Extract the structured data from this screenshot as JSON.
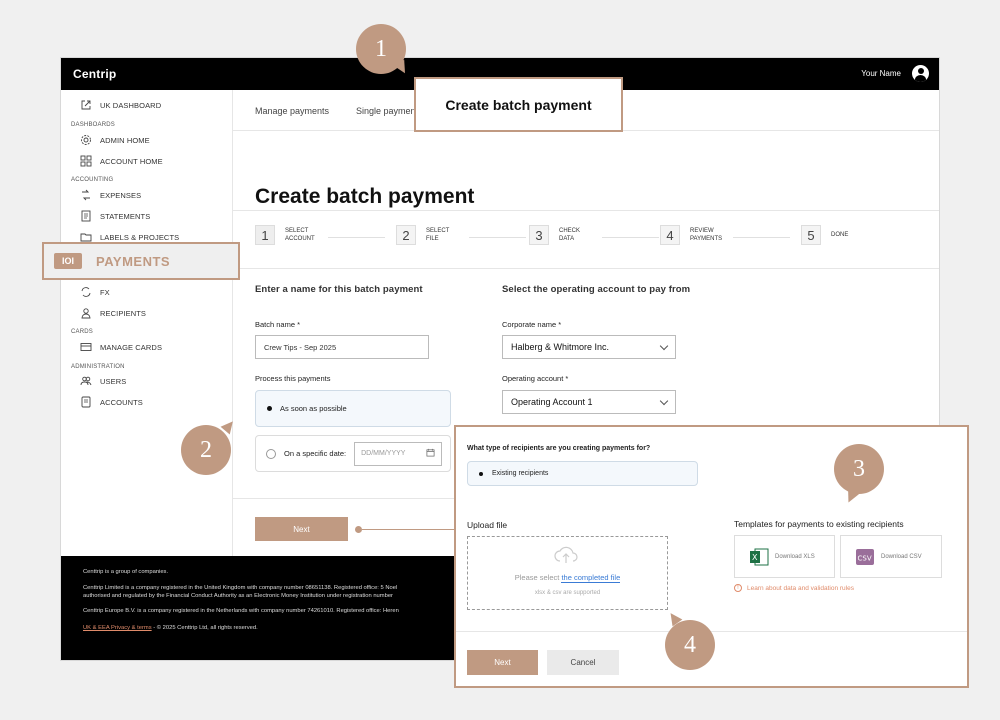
{
  "topbar": {
    "brand": "Centrip",
    "user_name": "Your Name"
  },
  "sidebar": {
    "uk_dashboard": "UK DASHBOARD",
    "section_dashboards": "DASHBOARDS",
    "admin_home": "ADMIN HOME",
    "account_home": "ACCOUNT HOME",
    "section_accounting": "ACCOUNTING",
    "expenses": "EXPENSES",
    "statements": "STATEMENTS",
    "labels_projects": "LABELS & PROJECTS",
    "payments": "PAYMENTS",
    "fx": "FX",
    "recipients": "RECIPIENTS",
    "section_cards": "CARDS",
    "manage_cards": "MANAGE CARDS",
    "section_administration": "ADMINISTRATION",
    "users": "USERS",
    "accounts": "ACCOUNTS"
  },
  "tabs": {
    "manage_payments": "Manage payments",
    "single_payment": "Single paymen",
    "create_batch": "Create batch payment"
  },
  "page": {
    "title": "Create batch payment"
  },
  "steps": [
    {
      "num": "1",
      "label_l1": "SELECT",
      "label_l2": "ACCOUNT"
    },
    {
      "num": "2",
      "label_l1": "SELECT",
      "label_l2": "FILE"
    },
    {
      "num": "3",
      "label_l1": "CHECK",
      "label_l2": "DATA"
    },
    {
      "num": "4",
      "label_l1": "REVIEW",
      "label_l2": "PAYMENTS"
    },
    {
      "num": "5",
      "label_l1": "DONE",
      "label_l2": ""
    }
  ],
  "form": {
    "name_section": "Enter a name for this batch payment",
    "batch_name_label": "Batch name *",
    "batch_name_value": "Crew Tips - Sep 2025",
    "process_label": "Process this payments",
    "asap": "As soon as possible",
    "specific_date": "On a specific date:",
    "date_placeholder": "DD/MM/YYYY",
    "account_section": "Select the operating account to pay from",
    "corporate_label": "Corporate name *",
    "corporate_value": "Halberg & Whitmore Inc.",
    "operating_label": "Operating account *",
    "operating_value": "Operating Account 1",
    "next": "Next"
  },
  "footer": {
    "line1": "Centtrip is a group of companies.",
    "line2": "Centtrip Limited is a company registered in the United Kingdom with company number 08651138. Registered office: 5 Noel",
    "line3": "authorised and regulated by the Financial Conduct Authority as an Electronic Money Institution under registration number",
    "line4": "Centtrip Europe B.V. is a company registered in the Netherlands with company number 74261010. Registered office: Heren",
    "link": "UK & EEA Privacy & terms",
    "copyright": " - © 2025 Centtrip Ltd, all rights reserved."
  },
  "panel": {
    "question": "What type of recipients are you creating payments for?",
    "existing": "Existing recipients",
    "upload_label": "Upload file",
    "upload_prompt": "Please select ",
    "upload_link": "the completed file",
    "upload_hint": "xlsx & csv are supported",
    "templates_title": "Templates for payments to existing recipients",
    "download_xls": "Download XLS",
    "download_csv": "Download CSV",
    "learn_more": "Learn about data and validation rules",
    "next": "Next",
    "cancel": "Cancel"
  },
  "badges": {
    "b1": "1",
    "b2": "2",
    "b3": "3",
    "b4": "4"
  },
  "colors": {
    "accent": "#c09a82",
    "link": "#3a7bd5",
    "footer_link": "#e08b6a"
  }
}
